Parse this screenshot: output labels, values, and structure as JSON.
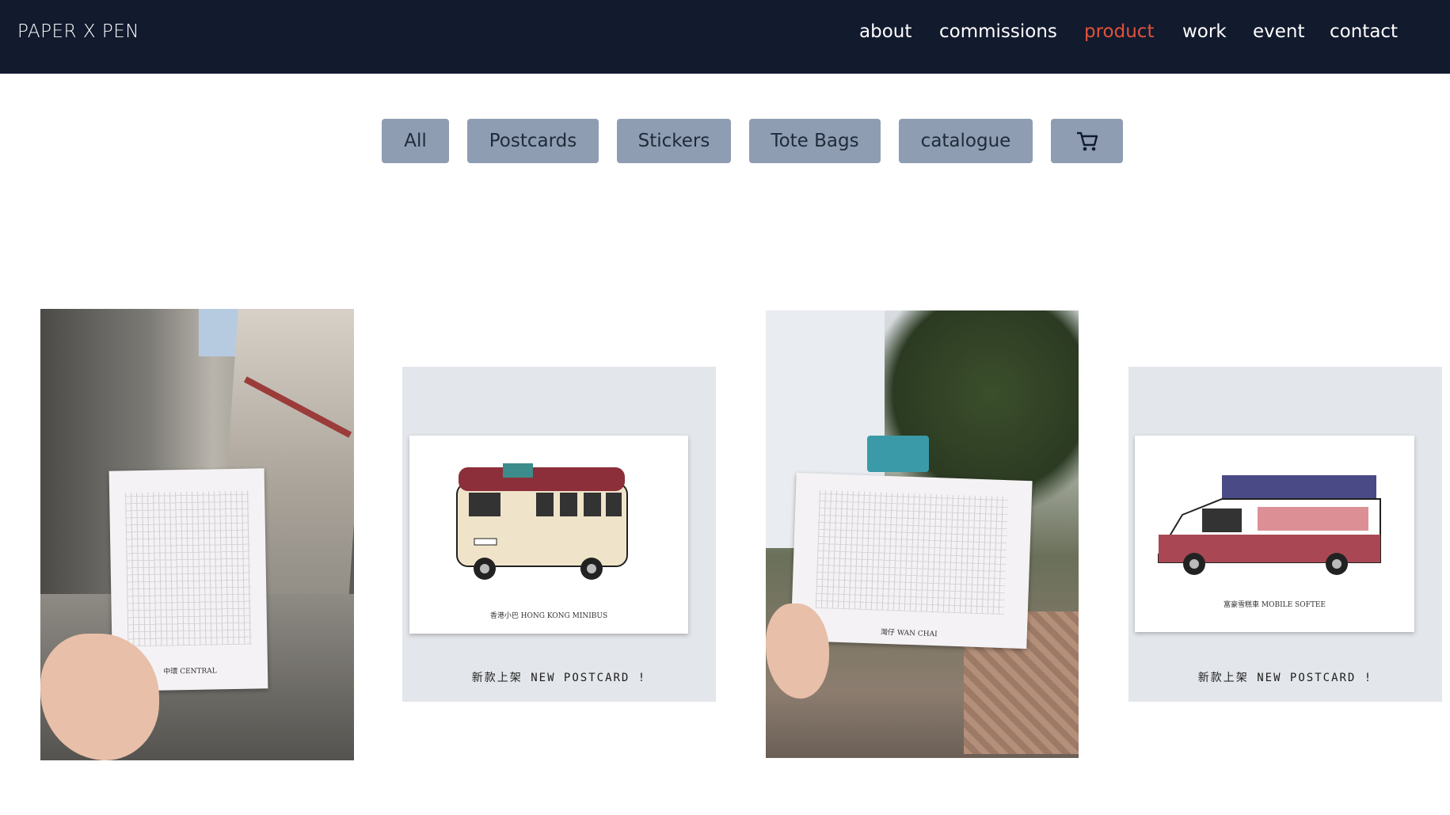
{
  "site": {
    "logo": "PAPER X PEN"
  },
  "nav": {
    "items": [
      {
        "label": "about",
        "active": false
      },
      {
        "label": "commissions",
        "active": false
      },
      {
        "label": "product",
        "active": true
      },
      {
        "label": "work",
        "active": false
      },
      {
        "label": "event",
        "active": false
      },
      {
        "label": "contact",
        "active": false
      }
    ],
    "active_color": "#e0533a"
  },
  "filters": {
    "items": [
      "All",
      "Postcards",
      "Stickers",
      "Tote Bags",
      "catalogue"
    ],
    "cart_icon": "shopping-cart-icon"
  },
  "gallery": {
    "tiles": [
      {
        "kind": "photo",
        "postcard_caption": "中環 CENTRAL"
      },
      {
        "kind": "postcard",
        "tagline": "新款上架 NEW POSTCARD !",
        "caption": "香港小巴 HONG KONG MINIBUS"
      },
      {
        "kind": "photo",
        "postcard_caption": "灣仔 WAN CHAI"
      },
      {
        "kind": "postcard",
        "tagline": "新款上架 NEW POSTCARD !",
        "caption": "富豪雪糕車 MOBILE SOFTEE"
      }
    ]
  }
}
